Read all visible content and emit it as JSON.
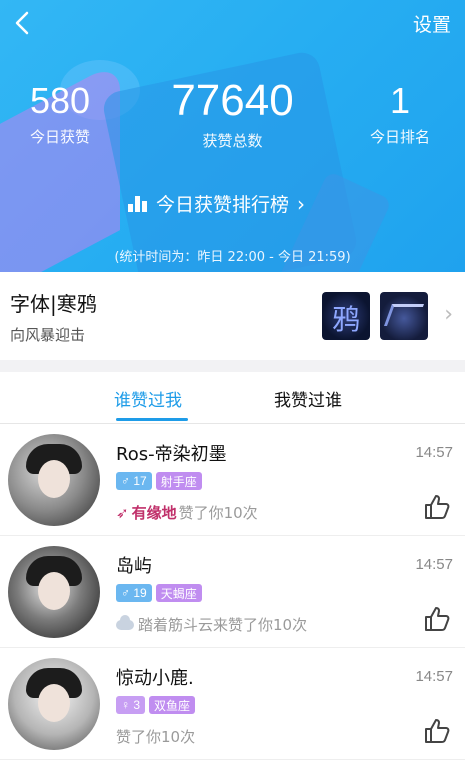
{
  "header": {
    "settings_label": "设置",
    "stats": {
      "today_likes": {
        "value": "580",
        "label": "今日获赞"
      },
      "total_likes": {
        "value": "77640",
        "label": "获赞总数"
      },
      "today_rank": {
        "value": "1",
        "label": "今日排名"
      }
    },
    "ranking_label": "今日获赞排行榜",
    "stat_period": "(统计时间为：昨日 22:00 - 今日 21:59)"
  },
  "font": {
    "title": "字体|寒鸦",
    "subtitle": "向风暴迎击"
  },
  "tabs": {
    "who_liked_me": "谁赞过我",
    "i_liked_who": "我赞过谁"
  },
  "likes": [
    {
      "name": "Ros-帝染初墨",
      "time": "14:57",
      "gender": "♂",
      "age": "17",
      "zodiac": "射手座",
      "prefix": "有缘地",
      "text": "赞了你10次"
    },
    {
      "name": "岛屿",
      "time": "14:57",
      "gender": "♂",
      "age": "19",
      "zodiac": "天蝎座",
      "prefix": "",
      "text": "踏着筋斗云来赞了你10次"
    },
    {
      "name": "惊动小鹿.",
      "time": "14:57",
      "gender": "♀",
      "age": "3",
      "zodiac": "双鱼座",
      "prefix": "",
      "text": "赞了你10次"
    }
  ],
  "colors": {
    "header_blue": "#27aef2",
    "tab_active": "#1e9ce8",
    "fate_red": "#c0306a"
  }
}
